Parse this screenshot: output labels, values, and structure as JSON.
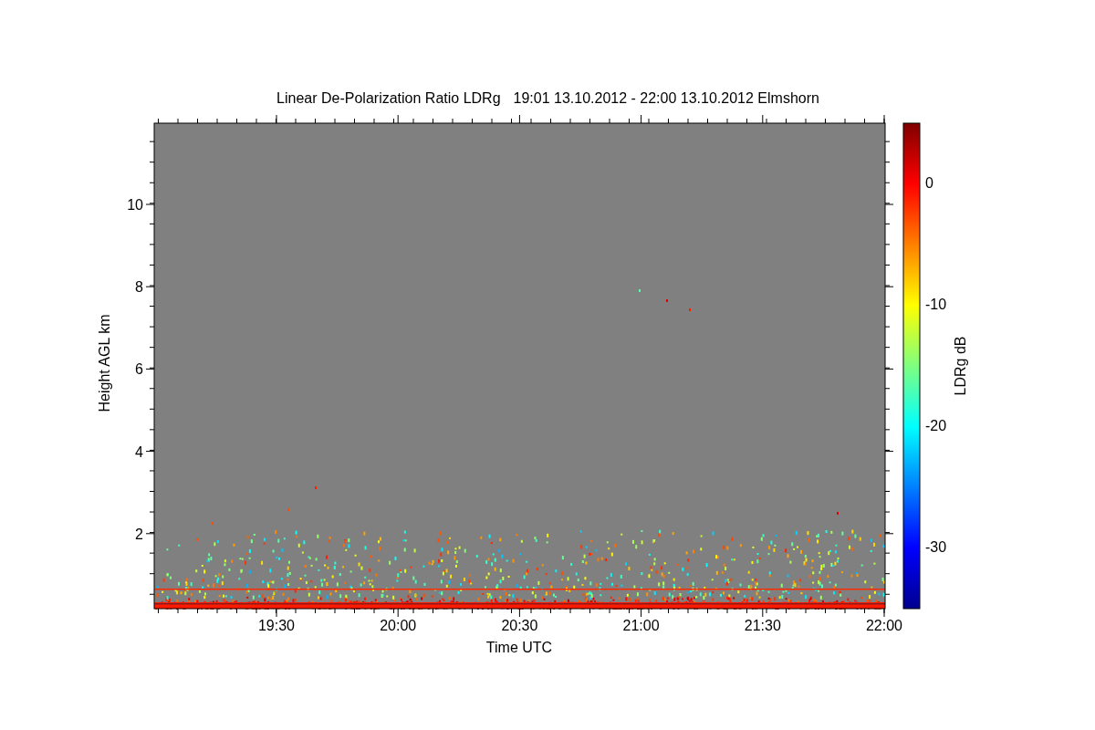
{
  "title": {
    "name": "Linear De-Polarization Ratio LDRg",
    "period": "19:01 13.10.2012 - 22:00 13.10.2012 Elmshorn"
  },
  "plot": {
    "xlabel": "Time UTC",
    "ylabel": "Height AGL km",
    "xticks": [
      "19:30",
      "20:00",
      "20:30",
      "21:00",
      "21:30",
      "22:00"
    ],
    "yticks": [
      "10",
      "8",
      "6",
      "4",
      "2"
    ]
  },
  "colorbar": {
    "label": "LDRg dB",
    "ticks": [
      "0",
      "-10",
      "-20",
      "-30"
    ]
  }
}
